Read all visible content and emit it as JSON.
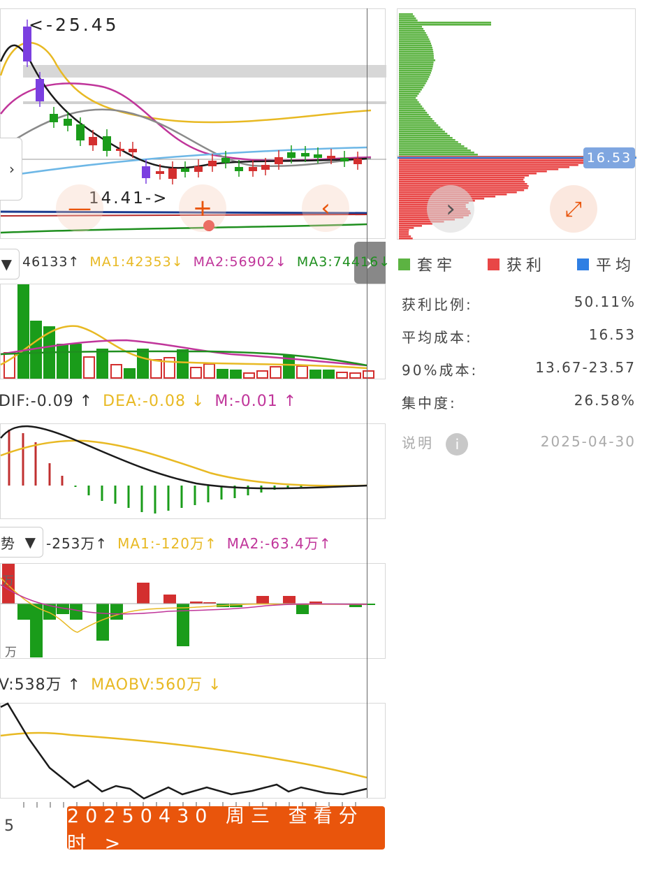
{
  "kline": {
    "high_marker": "<-25.45",
    "low_marker": "14.41->"
  },
  "volume_legend": {
    "vol": "46133↑",
    "ma1": "MA1:42353↓",
    "ma2": "MA2:56902↓",
    "ma3": "MA3:74416↓"
  },
  "macd_legend": {
    "dif": "DIF:-0.09 ↑",
    "dea": "DEA:-0.08 ↓",
    "m": "M:-0.01 ↑"
  },
  "fund_legend": {
    "selector": "势",
    "value": "-253万↑",
    "ma1": "MA1:-120万↑",
    "ma2": "MA2:-63.4万↑",
    "axis_top": "万",
    "axis_bottom": "万"
  },
  "obv_legend": {
    "obv": "V:538万 ↑",
    "maobv": "MAOBV:560万 ↓"
  },
  "x_axis": {
    "label": "5"
  },
  "cost": {
    "price_tag": "16.53",
    "legend": [
      {
        "label": "套牢",
        "color": "#5cb342"
      },
      {
        "label": "获利",
        "color": "#e84646"
      },
      {
        "label": "平均",
        "color": "#2f7fe3"
      }
    ],
    "stats": [
      {
        "label": "获利比例:",
        "value": "50.11%"
      },
      {
        "label": "平均成本:",
        "value": "16.53"
      },
      {
        "label": "90%成本:",
        "value": "13.67-23.57"
      },
      {
        "label": "集中度:",
        "value": "26.58%"
      }
    ],
    "note_label": "说明",
    "date": "2025-04-30"
  },
  "bottom_button": "20250430 周三 查看分时 >",
  "colors": {
    "up": "#d32f2f",
    "down": "#1a9c1a",
    "ma1": "#e8b923",
    "ma2": "#c0359a",
    "ma3": "#1f8f1f",
    "accent": "#e9550c"
  },
  "icons": [
    "minus-icon",
    "plus-icon",
    "back-icon",
    "chevron-right-icon",
    "expand-icon",
    "info-icon",
    "dropdown-icon"
  ]
}
